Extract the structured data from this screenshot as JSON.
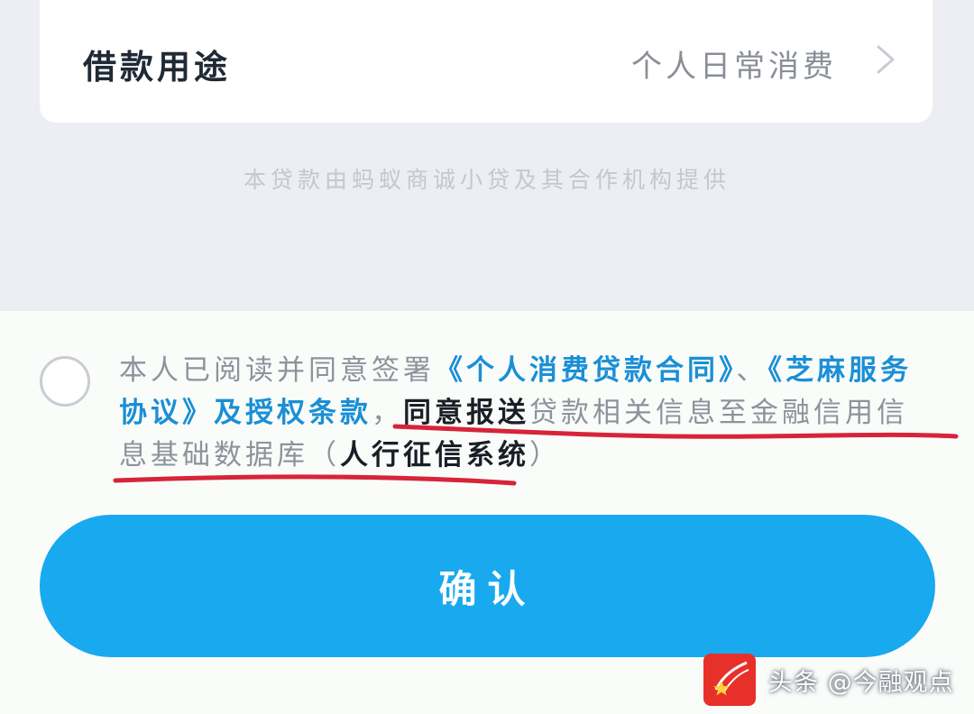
{
  "loan_purpose": {
    "label": "借款用途",
    "value": "个人日常消费",
    "icon": "chevron-right-icon"
  },
  "provider_notice": "本贷款由蚂蚁商诚小贷及其合作机构提供",
  "agreement": {
    "prefix": "本人已阅读并同意签署",
    "link_contract": "《个人消费贷款合同》",
    "separator": "、",
    "link_sesame": "《芝麻服务协议》",
    "link_authorization": "及授权条款",
    "comma": "，",
    "consent_bold": "同意报送",
    "consent_rest": "贷款相关信息至金融信用信息基础数据库",
    "paren_open": "（",
    "credit_system": "人行征信系统",
    "paren_close": "）"
  },
  "confirm_label": "确认",
  "watermark": {
    "text": "头条 @今融观点",
    "logo_icon": "toutiao-logo-icon"
  },
  "colors": {
    "accent": "#18a9ef",
    "link": "#1a8fd6",
    "annotation": "#d6243a",
    "logo": "#e8302a"
  }
}
